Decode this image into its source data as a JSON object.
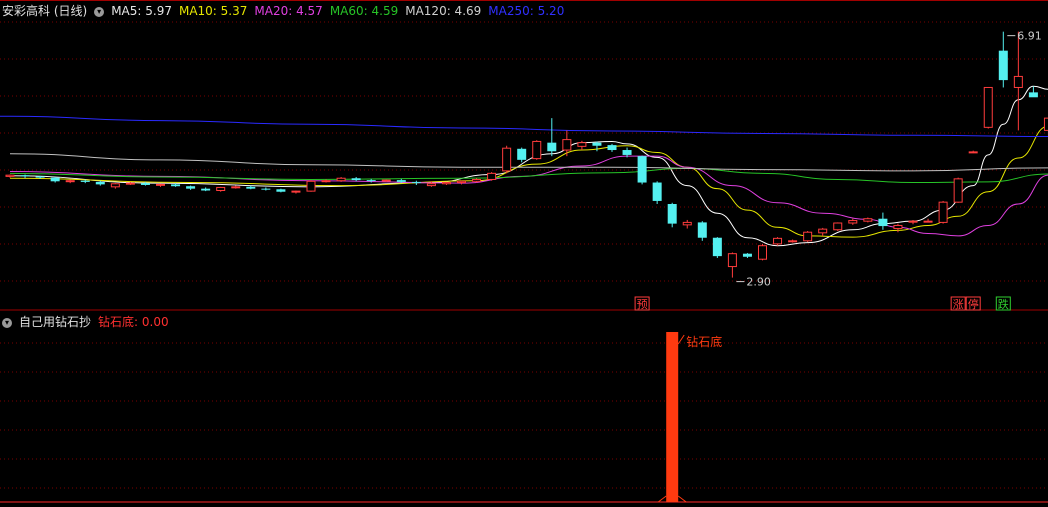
{
  "main_header": {
    "title": "安彩高科 (日线)",
    "icon": "chevron-down-icon",
    "indicators": [
      {
        "label": "MA5: 5.97",
        "color": "#e6e6e6"
      },
      {
        "label": "MA10: 5.37",
        "color": "#e6e600"
      },
      {
        "label": "MA20: 4.57",
        "color": "#e040e0"
      },
      {
        "label": "MA60: 4.59",
        "color": "#27c427"
      },
      {
        "label": "MA120: 4.69",
        "color": "#d0d0d0"
      },
      {
        "label": "MA250: 5.20",
        "color": "#3030ff"
      }
    ]
  },
  "sub_header": {
    "title": "自己用钻石抄",
    "icon": "chevron-down-icon",
    "indicator": {
      "label": "钻石底: 0.00",
      "color": "#ff3030"
    }
  },
  "colors": {
    "up": "#ff3c3c",
    "down": "#54f0f0",
    "grid": "#7a0000",
    "ma5": "#ffffff",
    "ma10": "#e6e600",
    "ma20": "#e040e0",
    "ma60": "#27c427",
    "ma120": "#c0c0c0",
    "ma250": "#2a2aff",
    "diamond_bar": "#ff3a10"
  },
  "chart_data": [
    {
      "type": "candlestick",
      "title": "安彩高科 (日线)",
      "ylim": [
        2.6,
        7.1
      ],
      "candles": [
        [
          4.55,
          4.58,
          4.53,
          4.57
        ],
        [
          4.57,
          4.58,
          4.52,
          4.55
        ],
        [
          4.55,
          4.56,
          4.51,
          4.53
        ],
        [
          4.53,
          4.54,
          4.45,
          4.47
        ],
        [
          4.47,
          4.5,
          4.44,
          4.48
        ],
        [
          4.48,
          4.5,
          4.44,
          4.46
        ],
        [
          4.46,
          4.48,
          4.4,
          4.42
        ],
        [
          4.38,
          4.44,
          4.35,
          4.43
        ],
        [
          4.43,
          4.46,
          4.41,
          4.44
        ],
        [
          4.44,
          4.46,
          4.4,
          4.41
        ],
        [
          4.41,
          4.43,
          4.38,
          4.42
        ],
        [
          4.42,
          4.44,
          4.38,
          4.39
        ],
        [
          4.39,
          4.4,
          4.33,
          4.35
        ],
        [
          4.35,
          4.37,
          4.31,
          4.32
        ],
        [
          4.32,
          4.38,
          4.3,
          4.37
        ],
        [
          4.37,
          4.4,
          4.35,
          4.38
        ],
        [
          4.38,
          4.4,
          4.34,
          4.35
        ],
        [
          4.35,
          4.37,
          4.32,
          4.34
        ],
        [
          4.34,
          4.35,
          4.29,
          4.3
        ],
        [
          4.3,
          4.32,
          4.27,
          4.31
        ],
        [
          4.31,
          4.49,
          4.3,
          4.47
        ],
        [
          4.47,
          4.5,
          4.45,
          4.48
        ],
        [
          4.48,
          4.54,
          4.46,
          4.52
        ],
        [
          4.52,
          4.54,
          4.47,
          4.49
        ],
        [
          4.49,
          4.51,
          4.45,
          4.48
        ],
        [
          4.48,
          4.5,
          4.46,
          4.49
        ],
        [
          4.49,
          4.51,
          4.44,
          4.46
        ],
        [
          4.46,
          4.48,
          4.41,
          4.45
        ],
        [
          4.4,
          4.47,
          4.38,
          4.43
        ],
        [
          4.43,
          4.46,
          4.41,
          4.45
        ],
        [
          4.45,
          4.48,
          4.42,
          4.47
        ],
        [
          4.47,
          4.52,
          4.45,
          4.5
        ],
        [
          4.5,
          4.62,
          4.48,
          4.6
        ],
        [
          4.64,
          5.05,
          4.6,
          5.01
        ],
        [
          5.0,
          5.02,
          4.78,
          4.82
        ],
        [
          4.84,
          5.14,
          4.82,
          5.12
        ],
        [
          5.1,
          5.5,
          4.88,
          4.96
        ],
        [
          4.98,
          5.3,
          4.88,
          5.15
        ],
        [
          5.04,
          5.13,
          4.98,
          5.1
        ],
        [
          5.1,
          5.12,
          4.96,
          5.05
        ],
        [
          5.06,
          5.08,
          4.95,
          4.98
        ],
        [
          4.98,
          5.02,
          4.86,
          4.9
        ],
        [
          4.88,
          4.89,
          4.42,
          4.45
        ],
        [
          4.45,
          4.47,
          4.1,
          4.15
        ],
        [
          4.1,
          4.12,
          3.72,
          3.78
        ],
        [
          3.76,
          3.84,
          3.7,
          3.8
        ],
        [
          3.8,
          3.82,
          3.5,
          3.55
        ],
        [
          3.55,
          3.56,
          3.22,
          3.25
        ],
        [
          3.08,
          3.31,
          2.9,
          3.29
        ],
        [
          3.29,
          3.3,
          3.22,
          3.24
        ],
        [
          3.2,
          3.45,
          3.18,
          3.42
        ],
        [
          3.45,
          3.56,
          3.42,
          3.54
        ],
        [
          3.5,
          3.52,
          3.47,
          3.5
        ],
        [
          3.5,
          3.66,
          3.48,
          3.64
        ],
        [
          3.63,
          3.71,
          3.58,
          3.69
        ],
        [
          3.68,
          3.8,
          3.66,
          3.79
        ],
        [
          3.79,
          3.86,
          3.76,
          3.83
        ],
        [
          3.82,
          3.88,
          3.8,
          3.86
        ],
        [
          3.86,
          3.96,
          3.68,
          3.74
        ],
        [
          3.7,
          3.78,
          3.64,
          3.75
        ],
        [
          3.81,
          3.84,
          3.77,
          3.82
        ],
        [
          3.82,
          3.86,
          3.8,
          3.82
        ],
        [
          3.8,
          4.15,
          3.78,
          4.13
        ],
        [
          4.13,
          4.53,
          4.12,
          4.51
        ],
        [
          4.95,
          4.97,
          4.93,
          4.95
        ],
        [
          5.35,
          6.0,
          5.33,
          6.0
        ],
        [
          6.6,
          6.91,
          6.0,
          6.12
        ],
        [
          6.0,
          6.91,
          5.3,
          6.18
        ],
        [
          5.92,
          6.02,
          5.85,
          5.84
        ],
        [
          5.3,
          5.5,
          5.2,
          5.5
        ]
      ],
      "ma": {
        "MA5": [
          [
            0,
            4.56
          ],
          [
            10,
            4.44
          ],
          [
            20,
            4.38
          ],
          [
            28,
            4.45
          ],
          [
            32,
            4.58
          ],
          [
            36,
            4.92
          ],
          [
            38,
            5.1
          ],
          [
            40,
            5.12
          ],
          [
            41,
            5.08
          ],
          [
            43,
            4.86
          ],
          [
            45,
            4.4
          ],
          [
            47,
            3.95
          ],
          [
            49,
            3.55
          ],
          [
            51,
            3.42
          ],
          [
            53,
            3.47
          ],
          [
            56,
            3.68
          ],
          [
            58,
            3.78
          ],
          [
            60,
            3.82
          ],
          [
            62,
            4.0
          ],
          [
            64,
            4.4
          ],
          [
            65,
            4.9
          ],
          [
            66,
            5.4
          ],
          [
            67,
            5.8
          ],
          [
            68,
            6.02
          ],
          [
            69,
            5.97
          ]
        ],
        "MA10": [
          [
            0,
            4.52
          ],
          [
            12,
            4.45
          ],
          [
            22,
            4.4
          ],
          [
            31,
            4.48
          ],
          [
            35,
            4.75
          ],
          [
            38,
            4.98
          ],
          [
            41,
            5.05
          ],
          [
            43,
            4.94
          ],
          [
            45,
            4.7
          ],
          [
            47,
            4.35
          ],
          [
            49,
            4.0
          ],
          [
            51,
            3.72
          ],
          [
            53,
            3.58
          ],
          [
            56,
            3.56
          ],
          [
            59,
            3.67
          ],
          [
            61,
            3.75
          ],
          [
            63,
            3.9
          ],
          [
            65,
            4.3
          ],
          [
            67,
            4.85
          ],
          [
            69,
            5.37
          ]
        ],
        "MA20": [
          [
            0,
            4.63
          ],
          [
            10,
            4.55
          ],
          [
            20,
            4.48
          ],
          [
            30,
            4.44
          ],
          [
            34,
            4.55
          ],
          [
            38,
            4.72
          ],
          [
            41,
            4.88
          ],
          [
            43,
            4.88
          ],
          [
            45,
            4.7
          ],
          [
            48,
            4.4
          ],
          [
            51,
            4.12
          ],
          [
            54,
            3.95
          ],
          [
            57,
            3.85
          ],
          [
            59,
            3.72
          ],
          [
            61,
            3.62
          ],
          [
            63,
            3.58
          ],
          [
            65,
            3.75
          ],
          [
            67,
            4.1
          ],
          [
            69,
            4.57
          ]
        ],
        "MA60": [
          [
            0,
            4.6
          ],
          [
            10,
            4.54
          ],
          [
            20,
            4.5
          ],
          [
            30,
            4.52
          ],
          [
            40,
            4.61
          ],
          [
            45,
            4.68
          ],
          [
            50,
            4.6
          ],
          [
            55,
            4.5
          ],
          [
            60,
            4.45
          ],
          [
            65,
            4.46
          ],
          [
            69,
            4.59
          ]
        ],
        "MA120": [
          [
            0,
            4.92
          ],
          [
            10,
            4.82
          ],
          [
            20,
            4.74
          ],
          [
            30,
            4.7
          ],
          [
            40,
            4.7
          ],
          [
            50,
            4.66
          ],
          [
            60,
            4.64
          ],
          [
            69,
            4.69
          ]
        ],
        "MA250": [
          [
            0,
            5.53
          ],
          [
            10,
            5.46
          ],
          [
            20,
            5.4
          ],
          [
            30,
            5.34
          ],
          [
            40,
            5.29
          ],
          [
            50,
            5.25
          ],
          [
            60,
            5.22
          ],
          [
            69,
            5.2
          ]
        ]
      },
      "annotations": [
        {
          "text": "6.91",
          "index": 66
        },
        {
          "text": "2.90",
          "index": 48
        }
      ],
      "markers": [
        {
          "text": "预",
          "index": 42,
          "color": "#ff3c3c"
        },
        {
          "text": "涨",
          "index": 63,
          "color": "#ff3c3c"
        },
        {
          "text": "停",
          "index": 64,
          "color": "#ff3c3c"
        },
        {
          "text": "跌",
          "index": 66,
          "color": "#2fd02f"
        }
      ]
    },
    {
      "type": "bar",
      "title": "自己用钻石抄",
      "series": [
        {
          "name": "钻石底",
          "values_nonzero": [
            {
              "index": 44,
              "value": 1
            }
          ]
        }
      ],
      "annotation": {
        "text": "钻石底",
        "index": 44
      }
    }
  ]
}
